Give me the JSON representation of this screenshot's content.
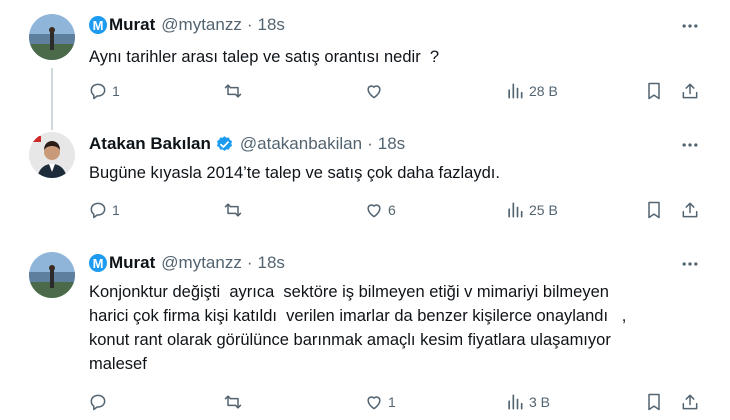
{
  "tweets": [
    {
      "name": "Murat",
      "handle": "@mytanzz",
      "dot": "·",
      "time": "18s",
      "text": "Aynı tarihler arası talep ve satış orantısı nedir  ?",
      "replies": "1",
      "retweets": "",
      "likes": "",
      "views": "28 B"
    },
    {
      "name": "Atakan Bakılan",
      "handle": "@atakanbakilan",
      "dot": "·",
      "time": "18s",
      "text": "Bugüne kıyasla 2014’te talep ve satış çok daha fazlaydı.",
      "replies": "1",
      "retweets": "",
      "likes": "6",
      "views": "25 B"
    },
    {
      "name": "Murat",
      "handle": "@mytanzz",
      "dot": "·",
      "time": "18s",
      "text": "Konjonktur değişti  ayrıca  sektöre iş bilmeyen etiği v mimariyi bilmeyen\nharici çok firma kişi katıldı  verilen imarlar da benzer kişilerce onaylandı   ,\nkonut rant olarak görülünce barınmak amaçlı kesim fiyatlara ulaşamıyor\nmalesef",
      "replies": "",
      "retweets": "",
      "likes": "1",
      "views": "3 B"
    }
  ],
  "icons": {
    "reply": "reply-icon",
    "retweet": "retweet-icon",
    "like": "heart-icon",
    "views": "views-icon",
    "bookmark": "bookmark-icon",
    "share": "share-icon",
    "more": "more-icon",
    "verified": "verified-badge-icon"
  },
  "colors": {
    "text": "#0f1419",
    "secondary": "#536471",
    "accent": "#1d9bf0",
    "thread_line": "#cfd9de"
  }
}
